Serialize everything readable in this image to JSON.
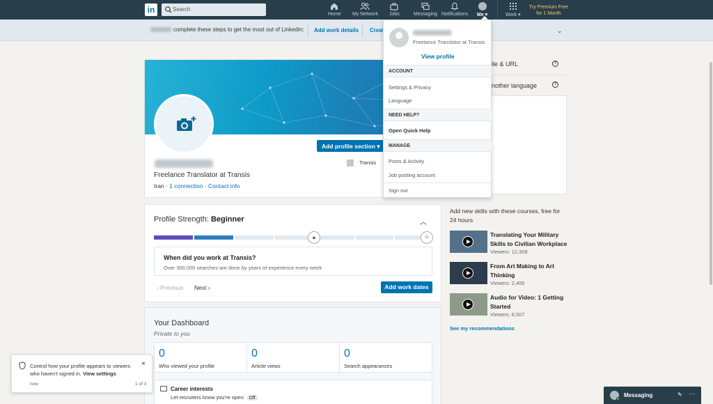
{
  "nav": {
    "logo": "in",
    "search_placeholder": "Search",
    "items": [
      {
        "label": "Home",
        "icon": "home-icon"
      },
      {
        "label": "My Network",
        "icon": "network-icon"
      },
      {
        "label": "Jobs",
        "icon": "briefcase-icon"
      },
      {
        "label": "Messaging",
        "icon": "messaging-icon"
      },
      {
        "label": "Notifications",
        "icon": "bell-icon"
      },
      {
        "label": "Me ▾",
        "icon": "avatar"
      }
    ],
    "work_label": "Work ▾",
    "premium_line1": "Try Premium Free",
    "premium_line2": "for 1 Month"
  },
  "banner": {
    "text": "complete these steps to get the most out of LinkedIn:",
    "link1": "Add work details",
    "link2": "Create",
    "chevron": "⌄"
  },
  "profile": {
    "headline": "Freelance Translator at Transis",
    "location": "Iran",
    "connections": "1 connection",
    "contact_info": "Contact info",
    "add_section": "Add profile section ▾",
    "company": "Transis",
    "separator": "·"
  },
  "strength": {
    "title_prefix": "Profile Strength: ",
    "level": "Beginner",
    "question": "When did you work at Transis?",
    "subtext": "Over 300,000 searches are done by years of experience every week",
    "previous": "‹  Previous",
    "next": "Next  ›",
    "add_dates": "Add work dates"
  },
  "dashboard": {
    "title": "Your Dashboard",
    "subtitle": "Private to you",
    "stats": [
      {
        "value": "0",
        "label": "Who viewed your profile"
      },
      {
        "value": "0",
        "label": "Article views"
      },
      {
        "value": "0",
        "label": "Search appearances"
      }
    ],
    "career_title": "Career interests",
    "career_desc": "Let recruiters know you're open:",
    "career_status": "Off"
  },
  "right": {
    "item1": "ile & URL",
    "item2": "nother language",
    "courses_head": "Add new skills with these courses, free for 24 hours",
    "courses": [
      {
        "title": "Translating Your Military Skills to Civilian Workplace",
        "viewers": "Viewers: 12,308"
      },
      {
        "title": "From Art Making to Art Thinking",
        "viewers": "Viewers: 2,455"
      },
      {
        "title": "Audio for Video: 1 Getting Started",
        "viewers": "Viewers: 6,507"
      }
    ],
    "see_recs": "See my recommendations"
  },
  "dropdown": {
    "headline": "Freelance Translator at Transis",
    "view_profile": "View profile",
    "account": "ACCOUNT",
    "settings": "Settings & Privacy",
    "language": "Language",
    "need_help": "NEED HELP?",
    "quick_help": "Open Quick Help",
    "manage": "MANAGE",
    "posts": "Posts & Activity",
    "job_posting": "Job posting account",
    "sign_out": "Sign out"
  },
  "toast": {
    "message": "Control how your profile appears to viewers who haven't signed in.",
    "link": "View settings",
    "close": "×",
    "time": "now",
    "page": "1 of 3"
  },
  "messaging": {
    "label": "Messaging",
    "compose": "✎",
    "more": "···"
  },
  "colors": {
    "nav_bg": "#283e4a",
    "brand": "#0073b1",
    "premium": "#f5c56e"
  }
}
